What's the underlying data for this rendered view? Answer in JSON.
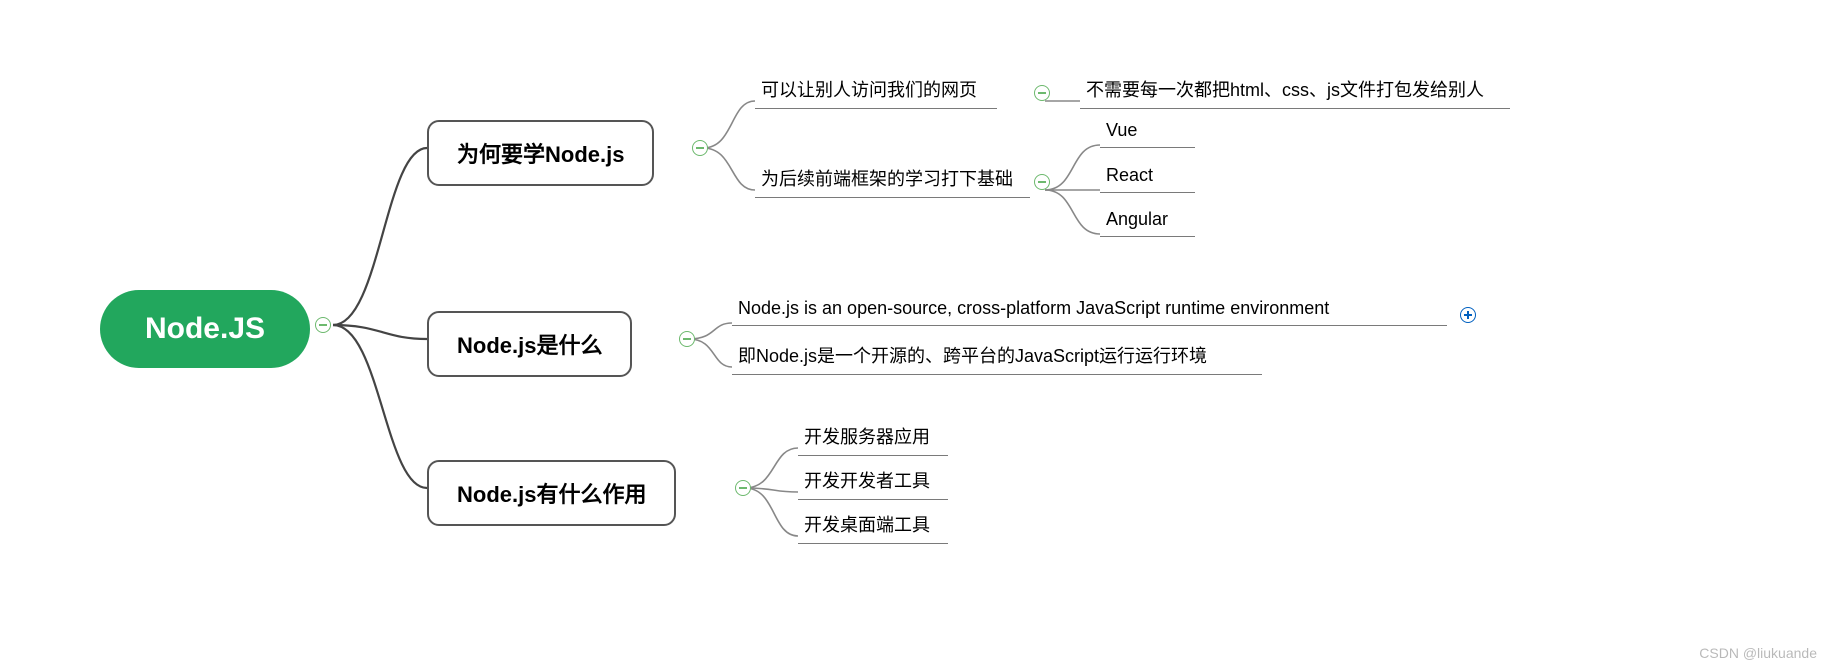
{
  "root": {
    "label": "Node.JS"
  },
  "topics": {
    "why": {
      "label": "为何要学Node.js"
    },
    "what": {
      "label": "Node.js是什么"
    },
    "use": {
      "label": "Node.js有什么作用"
    }
  },
  "why": {
    "l1": "可以让别人访问我们的网页",
    "l1_detail": "不需要每一次都把html、css、js文件打包发给别人",
    "l2": "为后续前端框架的学习打下基础",
    "frameworks": {
      "a": "Vue",
      "b": "React",
      "c": "Angular"
    }
  },
  "what": {
    "l1": "Node.js is an open-source, cross-platform  JavaScript runtime  environment",
    "l2": "即Node.js是一个开源的、跨平台的JavaScript运行运行环境"
  },
  "use": {
    "l1": "开发服务器应用",
    "l2": "开发开发者工具",
    "l3": "开发桌面端工具"
  },
  "watermark": "CSDN @liukuande"
}
